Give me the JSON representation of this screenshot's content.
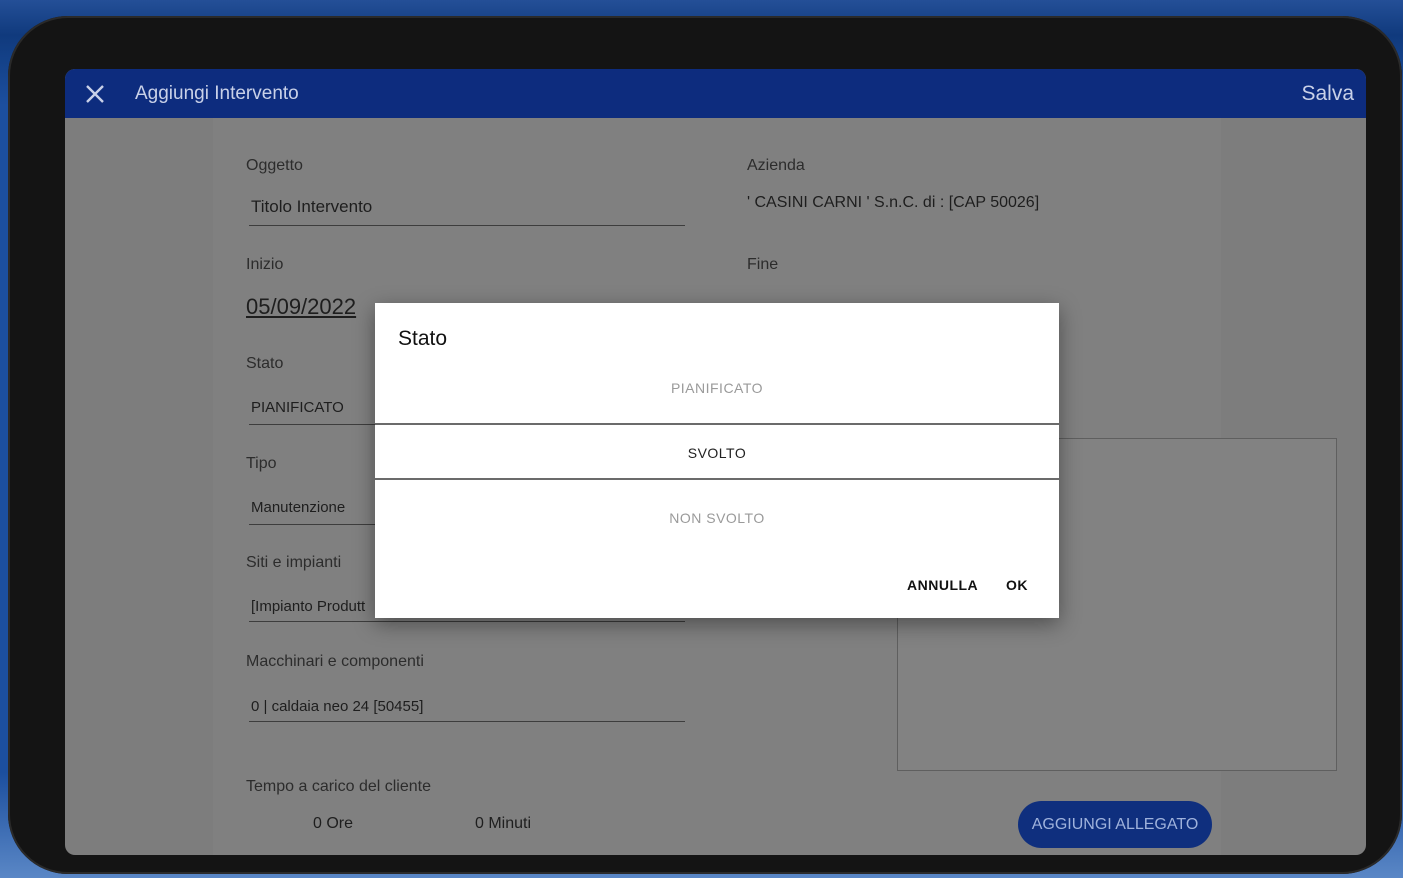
{
  "appbar": {
    "title": "Aggiungi Intervento",
    "save_label": "Salva"
  },
  "form": {
    "oggetto_label": "Oggetto",
    "oggetto_value": "Titolo Intervento",
    "azienda_label": "Azienda",
    "azienda_value": "' CASINI CARNI ' S.n.C. di : [CAP 50026]",
    "inizio_label": "Inizio",
    "inizio_date": "05/09/2022",
    "fine_label": "Fine",
    "stato_label": "Stato",
    "stato_value": "PIANIFICATO",
    "tipo_label": "Tipo",
    "tipo_value": "Manutenzione",
    "siti_label": "Siti e impianti",
    "siti_value": "[Impianto Produtt",
    "macchinari_label": "Macchinari e componenti",
    "macchinari_value": "0 | caldaia neo 24 [50455]",
    "tempo_label": "Tempo a carico del cliente",
    "ore_label": "0 Ore",
    "minuti_label": "0 Minuti",
    "attach_label": "AGGIUNGI ALLEGATO"
  },
  "dialog": {
    "title": "Stato",
    "options": [
      {
        "label": "PIANIFICATO",
        "color": "#9a9a9a"
      },
      {
        "label": "SVOLTO",
        "color": "#222222"
      },
      {
        "label": "NON SVOLTO",
        "color": "#9a9a9a"
      }
    ],
    "cancel_label": "ANNULLA",
    "ok_label": "OK"
  }
}
